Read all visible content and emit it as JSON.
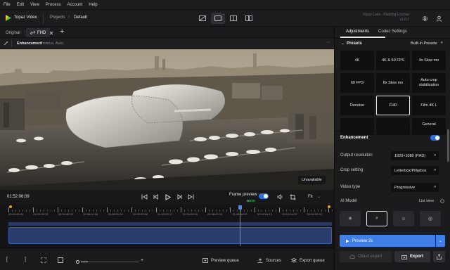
{
  "menu": [
    "File",
    "Edit",
    "View",
    "Process",
    "Account",
    "Help"
  ],
  "header": {
    "app_name": "Topaz Video",
    "crumb_projects": "Projects",
    "crumb_sep": "/",
    "crumb_current": "Default",
    "license_line1": "Topaz Labs - Floating License",
    "license_line2": "v1.0.1"
  },
  "tabs": {
    "original": "Original",
    "current": "FHD",
    "add": "+"
  },
  "enhancement": {
    "label": "Enhancement",
    "detail": "Proteus, Auto",
    "more": "···"
  },
  "viewer": {
    "badge": "Unavailable"
  },
  "transport": {
    "timecode": "01:52:06;09",
    "frame_preview": "Frame preview",
    "beta": "BETA",
    "fit": "Fit"
  },
  "timeline": {
    "ticks": [
      "00:00:00:00",
      "00:12:00:15",
      "00:24:00:22",
      "00:36:01:06",
      "00:48:01:20",
      "00:00:02:06",
      "01:12:02:17",
      "01:24:03:04",
      "01:36:03:15",
      "01:48:04:02",
      "02:00:04:12",
      "02:12:04:23",
      "02:24:03:10"
    ],
    "playhead_fraction": 0.716
  },
  "bottombar": {
    "preview_queue": "Preview queue",
    "sources": "Sources",
    "export_queue": "Export queue",
    "zoom_level": 0.12
  },
  "panel": {
    "tab_adjustments": "Adjustments",
    "tab_codec": "Codec Settings",
    "presets_title": "Presets",
    "presets_menu": "Built-In Presets",
    "presets": [
      {
        "label": "4K",
        "selected": false
      },
      {
        "label": "4K & 60 FPS",
        "selected": false
      },
      {
        "label": "4x Slow mo",
        "selected": false
      },
      {
        "label": "60 FPS",
        "selected": false
      },
      {
        "label": "8x Slow mo",
        "selected": false
      },
      {
        "label": "Auto crop stabilization",
        "selected": false
      },
      {
        "label": "Denoise",
        "selected": false
      },
      {
        "label": "FHD",
        "selected": true
      },
      {
        "label": "Film 4K L",
        "selected": false
      },
      {
        "label": "",
        "selected": false
      },
      {
        "label": "",
        "selected": false
      },
      {
        "label": "General",
        "selected": false
      }
    ],
    "enhancement_title": "Enhancement",
    "enhancement_on": true,
    "fields": [
      {
        "label": "Output resolution",
        "value": "1920×1080 (FHD)"
      },
      {
        "label": "Crop setting",
        "value": "Letterbox/Pillarbox"
      },
      {
        "label": "Video type",
        "value": "Progressive"
      }
    ],
    "ai_model_label": "AI Model",
    "list_view": "List view",
    "preview_button": "Preview 2s",
    "cloud_export": "Cloud export",
    "export": "Export"
  },
  "colors": {
    "accent": "#3f7fe6",
    "highlight": "#e0a020",
    "toggle": "#2f6fe0",
    "green_beta": "#3dbf6b"
  }
}
